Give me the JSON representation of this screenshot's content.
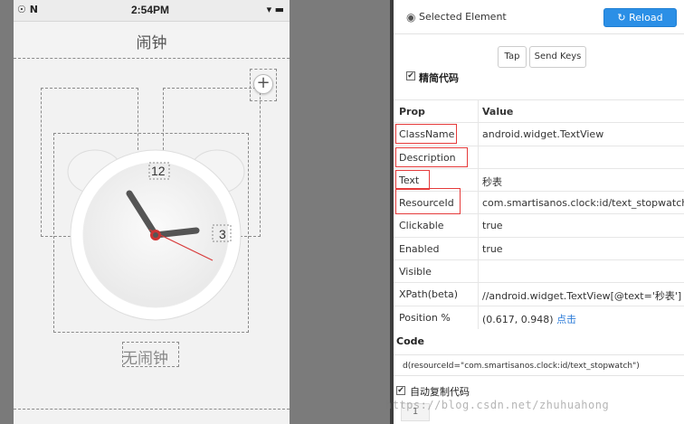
{
  "status_bar": {
    "left_icons": "☉ N",
    "time": "2:54PM",
    "right_icons": "▾ ▬"
  },
  "app": {
    "title": "闹钟",
    "add_symbol": "+",
    "clock": {
      "label_12": "12",
      "label_3": "3"
    },
    "no_alarm": "无闹钟"
  },
  "inspector": {
    "selected_label": "Selected Element",
    "reload_label": "↻ Reload",
    "tap_label": "Tap",
    "send_keys_label": "Send Keys",
    "simplify_label": "精简代码",
    "simplify_checked": "✔",
    "header": {
      "prop": "Prop",
      "value": "Value"
    },
    "props": [
      {
        "prop": "ClassName",
        "value": "android.widget.TextView"
      },
      {
        "prop": "Description",
        "value": ""
      },
      {
        "prop": "Text",
        "value": "秒表"
      },
      {
        "prop": "ResourceId",
        "value": "com.smartisanos.clock:id/text_stopwatch"
      },
      {
        "prop": "Clickable",
        "value": "true"
      },
      {
        "prop": "Enabled",
        "value": "true"
      },
      {
        "prop": "Visible",
        "value": ""
      },
      {
        "prop": "XPath(beta)",
        "value": "//android.widget.TextView[@text='秒表']"
      },
      {
        "prop": "Position %",
        "value": "(0.617, 0.948)",
        "link": "点击"
      }
    ],
    "code_label": "Code",
    "code_text": "d(resourceId=\"com.smartisanos.clock:id/text_stopwatch\")",
    "auto_copy_label": "自动复制代码",
    "auto_copy_checked": "✔",
    "line_number": "1"
  },
  "watermark": "https://blog.csdn.net/zhuhuahong",
  "colors": {
    "accent": "#2b8fe6",
    "highlight": "#e53b3b"
  }
}
